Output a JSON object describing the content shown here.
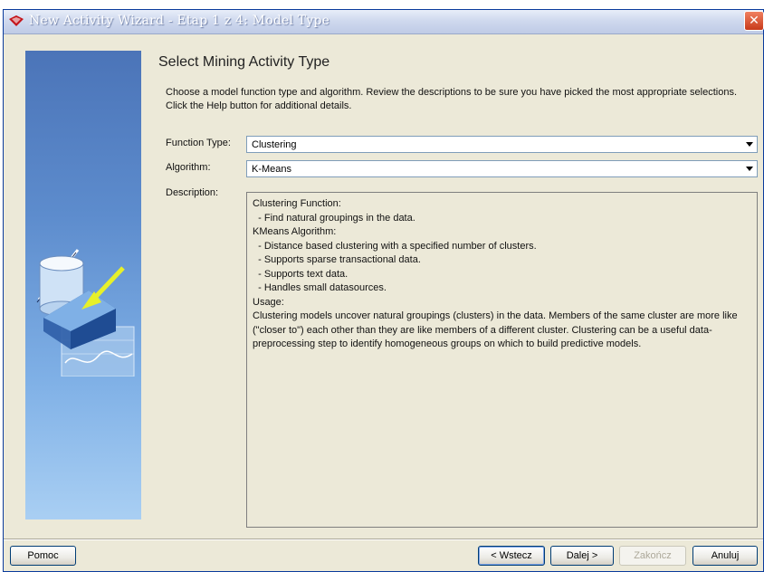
{
  "window": {
    "title": "New Activity Wizard - Etap 1 z 4: Model Type",
    "close_symbol": "✕"
  },
  "page": {
    "heading": "Select Mining Activity Type",
    "intro": "Choose a model function type and algorithm.  Review the descriptions to be sure you have picked the most appropriate selections. Click the Help button for additional details."
  },
  "form": {
    "function_type_label": "Function Type:",
    "function_type_value": "Clustering",
    "algorithm_label": "Algorithm:",
    "algorithm_value": "K-Means",
    "description_label": "Description:"
  },
  "description": {
    "lines": [
      "Clustering Function:",
      "",
      "  - Find natural groupings in the data.",
      "",
      "KMeans Algorithm:",
      "",
      "  - Distance based clustering with a specified number of clusters.",
      "  - Supports sparse transactional data.",
      "  - Supports text data.",
      "  - Handles small datasources.",
      "",
      "Usage:",
      "",
      "Clustering models uncover natural groupings (clusters) in the data. Members of the same cluster are more like (\"closer to\") each other than they are like members of a different cluster. Clustering can be a useful data-preprocessing step to identify homogeneous groups on which to build predictive models."
    ]
  },
  "buttons": {
    "help": "Pomoc",
    "back": "< Wstecz",
    "next": "Dalej >",
    "finish": "Zakończ",
    "cancel": "Anuluj"
  },
  "icons": {
    "title_icon": "app-logo-icon",
    "side_art": "data-mining-illustration-icon"
  },
  "colors": {
    "title_bar": "#cfd9ee",
    "side_panel_top": "#4b74b8",
    "side_panel_bottom": "#a9cff3",
    "dialog_bg": "#ece9d8"
  }
}
